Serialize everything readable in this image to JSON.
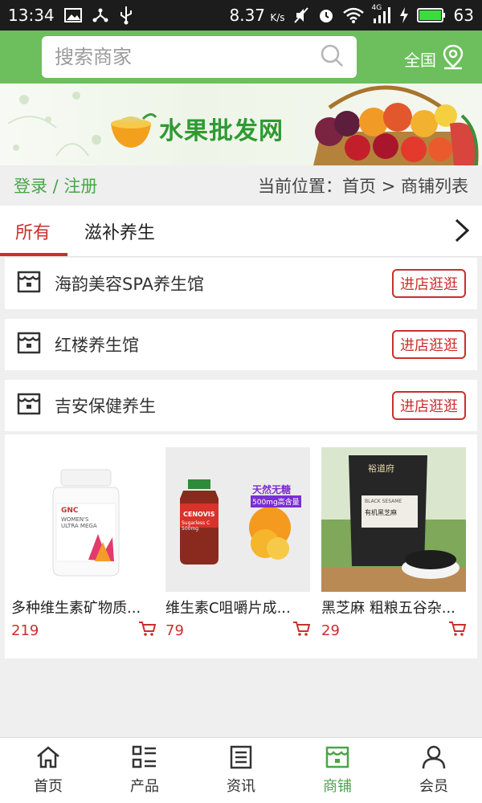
{
  "status_bar": {
    "time": "13:34",
    "network_speed": "8.37",
    "network_unit": "K/s",
    "signal_type": "4G",
    "battery_level": "63"
  },
  "header": {
    "search_placeholder": "搜索商家",
    "region_label": "全国"
  },
  "banner": {
    "title": "水果批发网"
  },
  "info_bar": {
    "login_label": "登录 / 注册",
    "breadcrumb": "当前位置：首页 > 商铺列表"
  },
  "tabs": [
    {
      "label": "所有",
      "active": true
    },
    {
      "label": "滋补养生",
      "active": false
    }
  ],
  "stores": [
    {
      "name": "海韵美容SPA养生馆",
      "button": "进店逛逛"
    },
    {
      "name": "红楼养生馆",
      "button": "进店逛逛"
    },
    {
      "name": "吉安保健养生",
      "button": "进店逛逛"
    }
  ],
  "products": [
    {
      "name": "多种维生素矿物质...",
      "price": "219",
      "image_brand": "GNC",
      "image_text": "WOMEN'S ULTRA MEGA"
    },
    {
      "name": "维生素C咀嚼片成...",
      "price": "79",
      "image_brand": "CENOVIS",
      "image_text": "Sugarless C 500mg",
      "image_badge": "天然无糖",
      "image_sub": "500mg高含量"
    },
    {
      "name": "黑芝麻 粗粮五谷杂...",
      "price": "29",
      "image_brand": "裕道府",
      "image_text": "有机黑芝麻",
      "image_sub": "BLACK SESAME"
    }
  ],
  "bottom_nav": [
    {
      "label": "首页",
      "icon": "home-icon",
      "active": false
    },
    {
      "label": "产品",
      "icon": "grid-list-icon",
      "active": false
    },
    {
      "label": "资讯",
      "icon": "news-icon",
      "active": false
    },
    {
      "label": "商铺",
      "icon": "shop-icon",
      "active": true
    },
    {
      "label": "会员",
      "icon": "user-icon",
      "active": false
    }
  ],
  "colors": {
    "brand_green": "#6cbf5c",
    "accent_red": "#c9302c",
    "link_green": "#4aa548"
  }
}
